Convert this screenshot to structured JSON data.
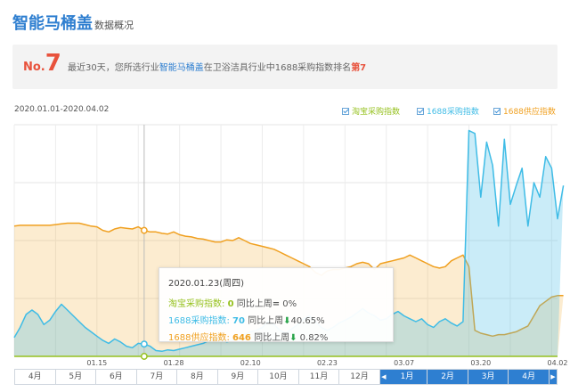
{
  "header": {
    "title": "智能马桶盖",
    "subtitle": "数据概况"
  },
  "rank": {
    "no_label": "No.",
    "no_value": "7",
    "text_prefix": "最近30天，您所选行业",
    "industry": "智能马桶盖",
    "text_middle": "在卫浴洁具行业中1688采购指数排名",
    "rank_text": "第7"
  },
  "range_label": "2020.01.01-2020.04.02",
  "legend": [
    {
      "label": "淘宝采购指数",
      "color": "#96c11f"
    },
    {
      "label": "1688采购指数",
      "color": "#3fbce6"
    },
    {
      "label": "1688供应指数",
      "color": "#f0a020"
    }
  ],
  "tooltip": {
    "date": "2020.01.23(周四)",
    "rows": [
      {
        "label": "淘宝采购指数:",
        "value": "0",
        "compare": "同比上周",
        "arrow": "=",
        "pct": "0%",
        "color": "#96c11f"
      },
      {
        "label": "1688采购指数:",
        "value": "70",
        "compare": "同比上周",
        "arrow": "⬇",
        "pct": "40.65%",
        "color": "#3fbce6"
      },
      {
        "label": "1688供应指数:",
        "value": "646",
        "compare": "同比上周",
        "arrow": "⬇",
        "pct": "0.82%",
        "color": "#f0a020"
      }
    ]
  },
  "months": {
    "left": [
      "4月",
      "5月",
      "6月",
      "7月",
      "8月",
      "9月",
      "10月",
      "11月",
      "12月"
    ],
    "left_nav": "◀",
    "right": [
      "1月",
      "2月",
      "3月",
      "4月"
    ],
    "right_nav": "▶"
  },
  "chart_data": {
    "type": "area",
    "x_start": "2020-01-01",
    "x_end": "2020-04-02",
    "x_ticks": [
      "01.15",
      "01.28",
      "02.10",
      "02.23",
      "03.07",
      "03.20",
      "04.02"
    ],
    "ylim": [
      0,
      1600
    ],
    "grid": true,
    "legend_position": "top-right",
    "highlight_date": "2020-01-23",
    "series": [
      {
        "name": "淘宝采购指数",
        "color": "#96c11f",
        "values": [
          0,
          0,
          0,
          0,
          0,
          0,
          0,
          0,
          0,
          0,
          0,
          0,
          0,
          0,
          0,
          0,
          0,
          0,
          0,
          0,
          0,
          0,
          0,
          0,
          0,
          0,
          0,
          0,
          0,
          0,
          0,
          0,
          0,
          0,
          0,
          0,
          0,
          0,
          0,
          0,
          0,
          0,
          0,
          0,
          0,
          0,
          0,
          0,
          0,
          0,
          0,
          0,
          0,
          0,
          0,
          0,
          0,
          0,
          0,
          0,
          0,
          0,
          0,
          0,
          0,
          0,
          0,
          0,
          0,
          0,
          0,
          0,
          0,
          0,
          0,
          0,
          0,
          0,
          0,
          0,
          0,
          0,
          0,
          0,
          0,
          0,
          0,
          0,
          0,
          0,
          0,
          0,
          0
        ]
      },
      {
        "name": "1688采购指数",
        "color": "#3fbce6",
        "values": [
          130,
          200,
          290,
          320,
          290,
          220,
          250,
          310,
          360,
          320,
          280,
          240,
          200,
          170,
          140,
          110,
          90,
          120,
          100,
          70,
          60,
          90,
          85,
          70,
          40,
          35,
          45,
          40,
          50,
          60,
          70,
          80,
          90,
          110,
          130,
          120,
          100,
          110,
          130,
          150,
          170,
          180,
          200,
          240,
          220,
          180,
          160,
          190,
          220,
          260,
          280,
          240,
          200,
          180,
          200,
          230,
          250,
          270,
          300,
          330,
          300,
          280,
          250,
          260,
          290,
          310,
          280,
          260,
          240,
          260,
          220,
          200,
          240,
          260,
          230,
          210,
          240,
          1560,
          1540,
          1100,
          1480,
          1320,
          900,
          1500,
          1050,
          1180,
          1300,
          900,
          1200,
          1100,
          1380,
          1300,
          950,
          1180
        ]
      },
      {
        "name": "1688供应指数",
        "color": "#f0a020",
        "values": [
          900,
          905,
          905,
          905,
          905,
          905,
          905,
          910,
          915,
          920,
          920,
          920,
          910,
          900,
          895,
          870,
          860,
          880,
          890,
          885,
          880,
          895,
          870,
          860,
          860,
          850,
          845,
          860,
          840,
          830,
          825,
          815,
          810,
          800,
          790,
          790,
          805,
          800,
          820,
          800,
          780,
          770,
          760,
          750,
          740,
          720,
          700,
          680,
          660,
          640,
          620,
          580,
          560,
          590,
          600,
          600,
          610,
          620,
          640,
          650,
          640,
          600,
          640,
          650,
          660,
          670,
          680,
          700,
          680,
          660,
          640,
          620,
          610,
          620,
          660,
          680,
          700,
          620,
          180,
          160,
          150,
          140,
          150,
          150,
          160,
          170,
          190,
          210,
          280,
          350,
          380,
          410,
          420,
          420
        ]
      }
    ]
  }
}
